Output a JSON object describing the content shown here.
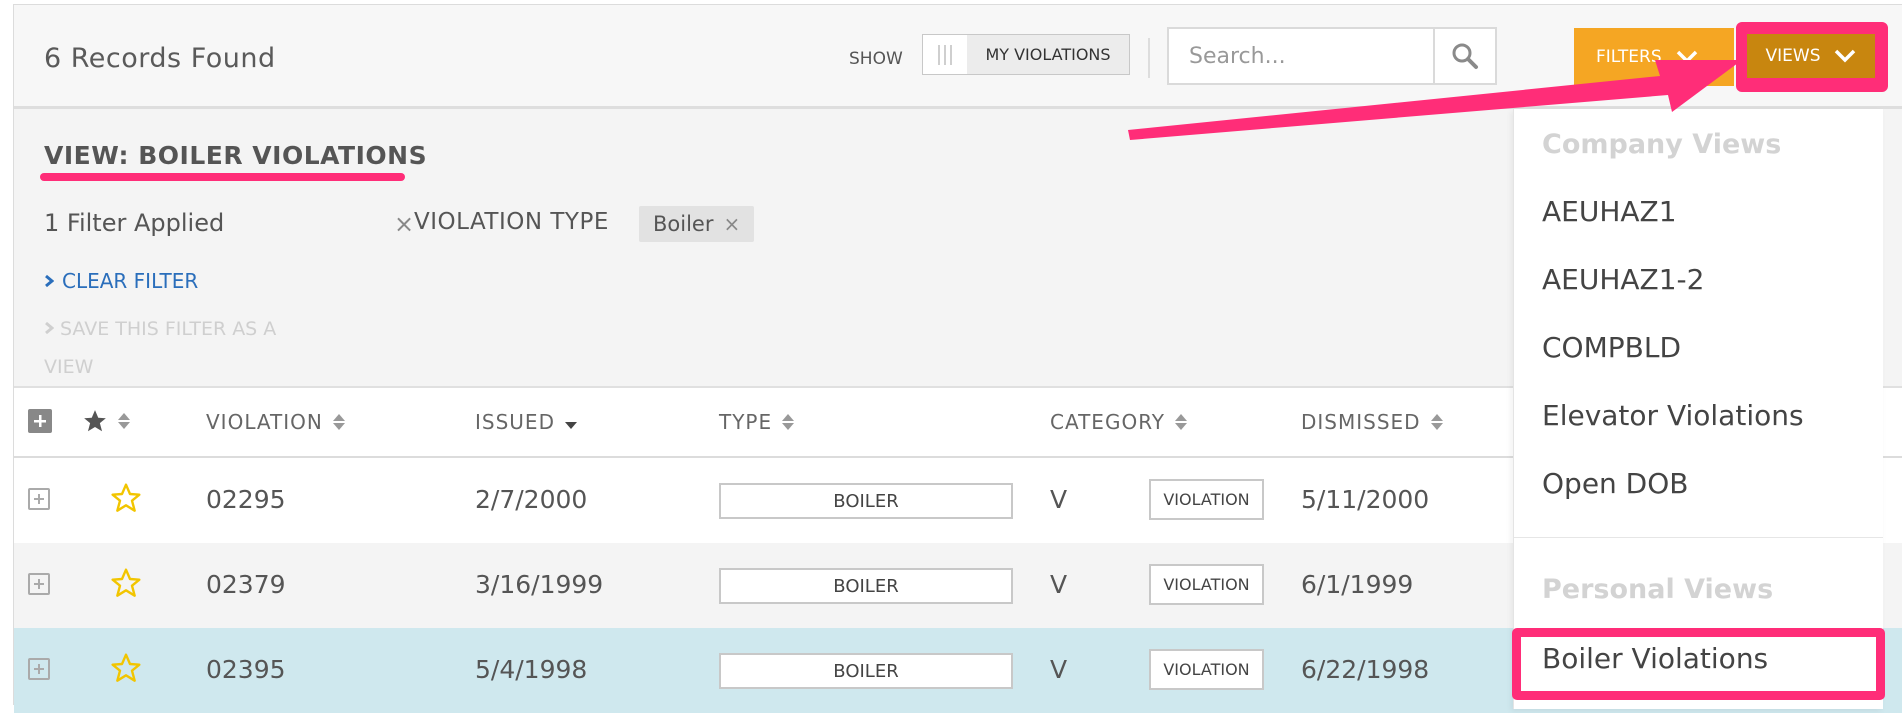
{
  "toolbar": {
    "records_found": "6 Records Found",
    "show_label": "SHOW",
    "toggle_label": "MY VIOLATIONS",
    "search_placeholder": "Search...",
    "filters_label": "FILTERS",
    "views_label": "VIEWS"
  },
  "filter_panel": {
    "view_title": "VIEW: BOILER VIOLATIONS",
    "filters_applied": "1 Filter Applied",
    "remove_symbol": "×",
    "filter_name": "VIOLATION TYPE",
    "filter_value": "Boiler",
    "clear_filter": "CLEAR FILTER",
    "save_filter": "SAVE THIS FILTER AS A VIEW"
  },
  "table": {
    "columns": {
      "violation": "VIOLATION",
      "issued": "ISSUED",
      "type": "TYPE",
      "category": "CATEGORY",
      "dismissed": "DISMISSED"
    },
    "rows": [
      {
        "violation": "02295",
        "issued": "2/7/2000",
        "type": "BOILER",
        "category_code": "V",
        "category": "VIOLATION",
        "dismissed": "5/11/2000"
      },
      {
        "violation": "02379",
        "issued": "3/16/1999",
        "type": "BOILER",
        "category_code": "V",
        "category": "VIOLATION",
        "dismissed": "6/1/1999"
      },
      {
        "violation": "02395",
        "issued": "5/4/1998",
        "type": "BOILER",
        "category_code": "V",
        "category": "VIOLATION",
        "dismissed": "6/22/1998"
      }
    ]
  },
  "views_dropdown": {
    "company_heading": "Company Views",
    "company_views": [
      "AEUHAZ1",
      "AEUHAZ1-2",
      "COMPBLD",
      "Elevator Violations",
      "Open DOB"
    ],
    "personal_heading": "Personal Views",
    "personal_views": [
      "Boiler Violations"
    ]
  },
  "colors": {
    "annotation_pink": "#ff2d78",
    "filters_orange": "#f5a623",
    "views_dark_orange": "#c8860f",
    "link_blue": "#2a6ebb",
    "highlight_row": "#cfe8ee",
    "star_yellow": "#f2c500"
  },
  "icons": [
    "search-icon",
    "chevron-down-icon",
    "chevron-right-icon",
    "star-icon",
    "expand-icon",
    "sort-icon",
    "close-icon"
  ]
}
